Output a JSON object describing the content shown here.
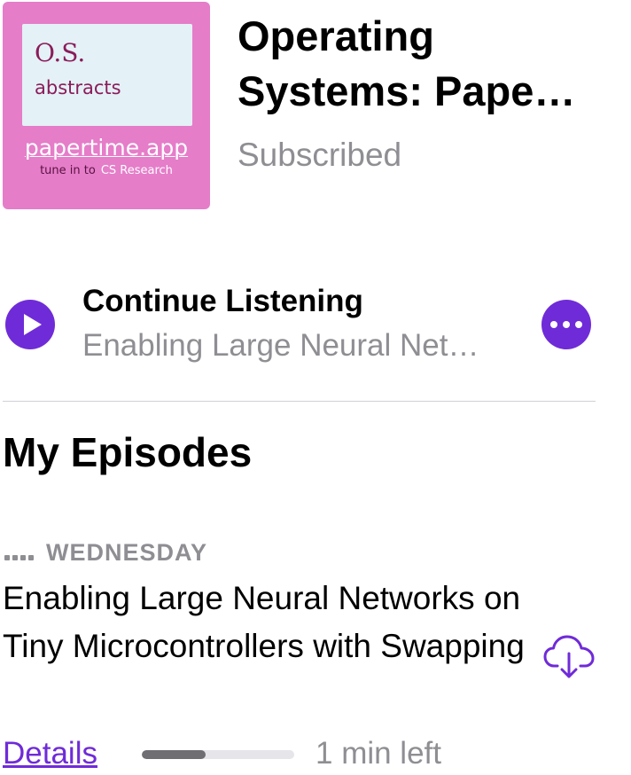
{
  "podcast": {
    "title_line1": "Operating",
    "title_line2": "Systems: Pape…",
    "status": "Subscribed",
    "artwork": {
      "line1": "O.S.",
      "line2": "abstracts",
      "site": "papertime.app",
      "tagline_a": "tune in to",
      "tagline_b": "CS Research"
    }
  },
  "continue": {
    "heading": "Continue Listening",
    "episode": "Enabling Large Neural Net…"
  },
  "section": {
    "title": "My Episodes"
  },
  "episodes": [
    {
      "day": "WEDNESDAY",
      "title": "Enabling Large Neural Networks on Tiny Microcontrollers with Swapping",
      "details_label": "Details",
      "time_left": "1 min left",
      "progress_fraction": 0.42
    }
  ],
  "colors": {
    "accent": "#6f2bd8",
    "artwork_bg": "#e57dc9",
    "secondary_text": "#8e8e93"
  },
  "icons": {
    "play": "play-icon",
    "more": "ellipsis-icon",
    "download": "cloud-download-icon",
    "unplayed": "dots-indicator-icon"
  }
}
